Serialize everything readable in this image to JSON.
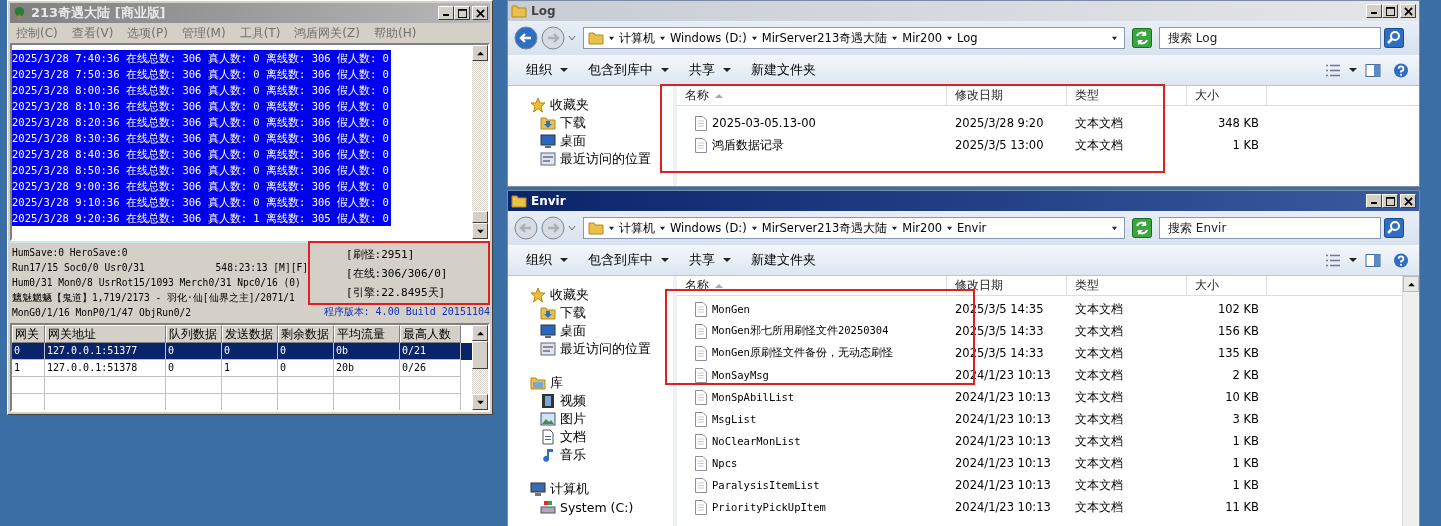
{
  "server_window": {
    "title": "213奇遇大陆 [商业版]",
    "menu": [
      "控制(C)",
      "查看(V)",
      "选项(P)",
      "管理(M)",
      "工具(T)",
      "鸿盾网关(Z)",
      "帮助(H)"
    ],
    "log_lines": [
      {
        "text": "2025/3/28 7:40:36 在线总数: 306 真人数: 0 离线数: 306 假人数: 0",
        "selected": true
      },
      {
        "text": "2025/3/28 7:50:36 在线总数: 306 真人数: 0 离线数: 306 假人数: 0",
        "selected": true
      },
      {
        "text": "2025/3/28 8:00:36 在线总数: 306 真人数: 0 离线数: 306 假人数: 0",
        "selected": true
      },
      {
        "text": "2025/3/28 8:10:36 在线总数: 306 真人数: 0 离线数: 306 假人数: 0",
        "selected": true
      },
      {
        "text": "2025/3/28 8:20:36 在线总数: 306 真人数: 0 离线数: 306 假人数: 0",
        "selected": true
      },
      {
        "text": "2025/3/28 8:30:36 在线总数: 306 真人数: 0 离线数: 306 假人数: 0",
        "selected": true
      },
      {
        "text": "2025/3/28 8:40:36 在线总数: 306 真人数: 0 离线数: 306 假人数: 0",
        "selected": true
      },
      {
        "text": "2025/3/28 8:50:36 在线总数: 306 真人数: 0 离线数: 306 假人数: 0",
        "selected": true
      },
      {
        "text": "2025/3/28 9:00:36 在线总数: 306 真人数: 0 离线数: 306 假人数: 0",
        "selected": true
      },
      {
        "text": "2025/3/28 9:10:36 在线总数: 306 真人数: 0 离线数: 306 假人数: 0",
        "selected": true
      },
      {
        "text": "2025/3/28 9:20:36 在线总数: 306 真人数: 1 离线数: 305 假人数: 0",
        "selected": true
      }
    ],
    "status_lines": [
      {
        "text": "HumSave:0 HeroSave:0"
      },
      {
        "text": "Run17/15 Soc0/0 Usr0/31",
        "right": "548:23:13 [M][F]"
      },
      {
        "text": "Hum0/31 Mon0/8 UsrRot15/1093 Merch0/31 Npc0/16 (0)"
      },
      {
        "text": "魑魅魍魉【鬼道】1,719/2173 - 羽化·仙[仙界之主]/2071/1"
      },
      {
        "text": "MonG0/1/16 MonP0/1/47 ObjRun0/2"
      }
    ],
    "stats": [
      "[刷怪:2951]",
      "[在线:306/306/0]",
      "[引擎:22.8495天]"
    ],
    "version": "程序版本: 4.00 Build 20151104",
    "gateway_table": {
      "columns": [
        "网关",
        "网关地址",
        "队列数据",
        "发送数据",
        "剩余数据",
        "平均流量",
        "最高人数"
      ],
      "rows": [
        {
          "cells": [
            "0",
            "127.0.0.1:51377",
            "0",
            "0",
            "0",
            "0b",
            "0/21"
          ],
          "selected": true
        },
        {
          "cells": [
            "1",
            "127.0.0.1:51378",
            "0",
            "1",
            "0",
            "20b",
            "0/26"
          ],
          "selected": false
        }
      ]
    }
  },
  "explorer_windows": [
    {
      "title": "Log",
      "active": false,
      "back_enabled": true,
      "breadcrumb": [
        "计算机",
        "Windows (D:)",
        "MirServer213奇遇大陆",
        "Mir200",
        "Log"
      ],
      "search": {
        "placeholder": "搜索 Log"
      },
      "toolbar": [
        {
          "label": "组织",
          "dropdown": true
        },
        {
          "label": "包含到库中",
          "dropdown": true
        },
        {
          "label": "共享",
          "dropdown": true
        },
        {
          "label": "新建文件夹",
          "dropdown": false
        }
      ],
      "nav": [
        {
          "label": "收藏夹",
          "kind": "favorites",
          "children": [
            {
              "label": "下载",
              "kind": "download"
            },
            {
              "label": "桌面",
              "kind": "desktop"
            },
            {
              "label": "最近访问的位置",
              "kind": "recent"
            }
          ]
        }
      ],
      "columns": [
        "名称",
        "修改日期",
        "类型",
        "大小"
      ],
      "files": [
        {
          "name": "2025-03-05.13-00",
          "modified": "2025/3/28 9:20",
          "type": "文本文档",
          "size": "348 KB"
        },
        {
          "name": "鸿盾数据记录",
          "modified": "2025/3/5 13:00",
          "type": "文本文档",
          "size": "1 KB"
        }
      ]
    },
    {
      "title": "Envir",
      "active": true,
      "back_enabled": false,
      "breadcrumb": [
        "计算机",
        "Windows (D:)",
        "MirServer213奇遇大陆",
        "Mir200",
        "Envir"
      ],
      "search": {
        "placeholder": "搜索 Envir"
      },
      "toolbar": [
        {
          "label": "组织",
          "dropdown": true
        },
        {
          "label": "包含到库中",
          "dropdown": true
        },
        {
          "label": "共享",
          "dropdown": true
        },
        {
          "label": "新建文件夹",
          "dropdown": false
        }
      ],
      "nav": [
        {
          "label": "收藏夹",
          "kind": "favorites",
          "children": [
            {
              "label": "下载",
              "kind": "download"
            },
            {
              "label": "桌面",
              "kind": "desktop"
            },
            {
              "label": "最近访问的位置",
              "kind": "recent"
            }
          ]
        },
        {
          "label": "库",
          "kind": "library",
          "children": [
            {
              "label": "视频",
              "kind": "video"
            },
            {
              "label": "图片",
              "kind": "pictures"
            },
            {
              "label": "文档",
              "kind": "documents"
            },
            {
              "label": "音乐",
              "kind": "music"
            }
          ]
        },
        {
          "label": "计算机",
          "kind": "computer",
          "children": [
            {
              "label": "System (C:)",
              "kind": "drive"
            }
          ]
        }
      ],
      "columns": [
        "名称",
        "修改日期",
        "类型",
        "大小"
      ],
      "files": [
        {
          "name": "MonGen",
          "modified": "2025/3/5 14:35",
          "type": "文本文档",
          "size": "102 KB"
        },
        {
          "name": "MonGen邪七所用刷怪文件20250304",
          "modified": "2025/3/5 14:33",
          "type": "文本文档",
          "size": "156 KB"
        },
        {
          "name": "MonGen原刷怪文件备份，无动态刷怪",
          "modified": "2025/3/5 14:33",
          "type": "文本文档",
          "size": "135 KB"
        },
        {
          "name": "MonSayMsg",
          "modified": "2024/1/23 10:13",
          "type": "文本文档",
          "size": "2 KB"
        },
        {
          "name": "MonSpAbilList",
          "modified": "2024/1/23 10:13",
          "type": "文本文档",
          "size": "10 KB"
        },
        {
          "name": "MsgList",
          "modified": "2024/1/23 10:13",
          "type": "文本文档",
          "size": "3 KB"
        },
        {
          "name": "NoClearMonList",
          "modified": "2024/1/23 10:13",
          "type": "文本文档",
          "size": "1 KB"
        },
        {
          "name": "Npcs",
          "modified": "2024/1/23 10:13",
          "type": "文本文档",
          "size": "1 KB"
        },
        {
          "name": "ParalysisItemList",
          "modified": "2024/1/23 10:13",
          "type": "文本文档",
          "size": "1 KB"
        },
        {
          "name": "PriorityPickUpItem",
          "modified": "2024/1/23 10:13",
          "type": "文本文档",
          "size": "11 KB"
        }
      ]
    }
  ]
}
